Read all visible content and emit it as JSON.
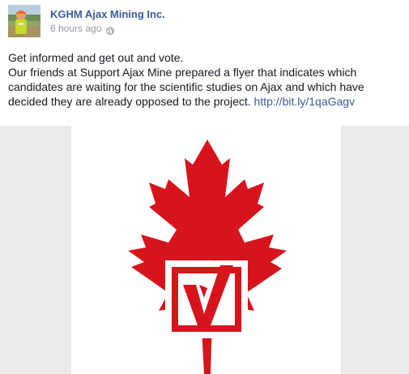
{
  "post": {
    "page_name": "KGHM Ajax Mining Inc.",
    "timestamp": "6 hours ago",
    "line1": "Get informed and get out and vote.",
    "line2_text": "Our friends at Support Ajax Mine prepared a flyer that indicates which candidates are waiting for the scientific studies on Ajax and which have decided they are already opposed to the project. ",
    "link": "http://bit.ly/1qaGagv"
  },
  "icons": {
    "privacy": "globe-icon"
  },
  "colors": {
    "link": "#3b5998",
    "text": "#141823",
    "muted": "#9197a3",
    "leaf": "#d7141b",
    "gutter": "#ebebeb"
  }
}
